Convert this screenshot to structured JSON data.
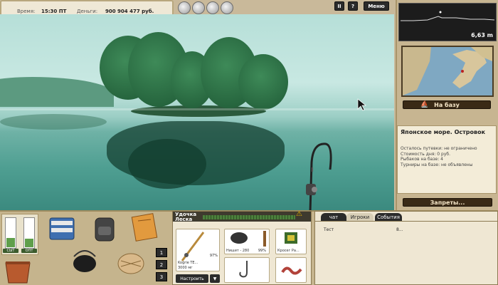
{
  "hud": {
    "time_label": "Время:",
    "time_value": "15:30 ПТ",
    "money_label": "Деньги:",
    "money_value": "900 904 477 руб."
  },
  "top_buttons": {
    "pause": "II",
    "help": "?",
    "menu": "Меню"
  },
  "depth": {
    "value": "6,63 m"
  },
  "location_button": "На базу",
  "info": {
    "title": "Японское море. Островок",
    "lines": [
      "Осталось путевки: не ограничено",
      "Стоимость дня: 0 руб.",
      "Рыбаков на базе: 4",
      "",
      "Турниры на базе: не объявлены"
    ]
  },
  "bans_button": "Запреты...",
  "gauges": {
    "left_label": "СЫТ",
    "right_label": "ОПТ"
  },
  "inventory_tabs": [
    "1",
    "2",
    "3"
  ],
  "tackle": {
    "header_line1": "Удочка",
    "header_line2": "Леска",
    "slots": [
      {
        "caption": "Kogrie TE...",
        "sub": "3000 мг",
        "pct": "97%"
      },
      {
        "caption": "Нишит - 280",
        "pct": "99%"
      },
      {
        "caption": "Кросег Ра..."
      }
    ],
    "adjust_button": "Настроить",
    "arrow_button": "▼"
  },
  "chat": {
    "tabs": [
      "чат",
      "Игроки",
      "События"
    ],
    "active_tab": 2,
    "message_left": "Тест",
    "message_right": "8..."
  },
  "colors": {
    "panel": "#c7b591",
    "dark_button": "#3a2a16",
    "lake": "#4f9f92",
    "tree": "#2d6f45"
  }
}
